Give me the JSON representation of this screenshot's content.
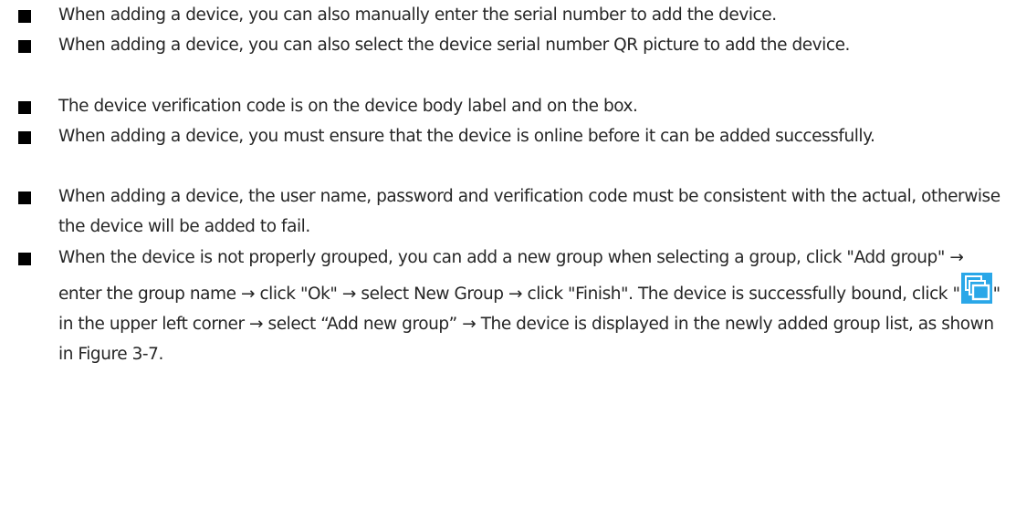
{
  "bullets": [
    {
      "text": "When adding a device, you can also manually enter the serial number to add the device."
    },
    {
      "text": "When adding a device, you can also select the device serial number QR picture to add the device."
    },
    {
      "text": "The device verification code is on the device body label and on the box."
    },
    {
      "text": "When adding a device, you must ensure that the device is online before it can be added successfully."
    },
    {
      "text": "When adding a device, the user name, password and verification code must be consistent with the actual, otherwise the device will be added to fail."
    },
    {
      "text_before_icon": "When the device is not properly grouped, you can add a new group when selecting a group, click \"Add group\" → enter the group name → click \"Ok\" → select New Group → click \"Finish\". The device is successfully bound, click \"",
      "icon": "multi-window-icon",
      "text_after_icon": "\" in the upper left corner → select “Add new group” → The device is displayed in the newly added group list, as shown in Figure 3-7."
    }
  ],
  "colors": {
    "text": "#262626",
    "bullet": "#000000",
    "icon_blue": "#2aa7e8"
  }
}
